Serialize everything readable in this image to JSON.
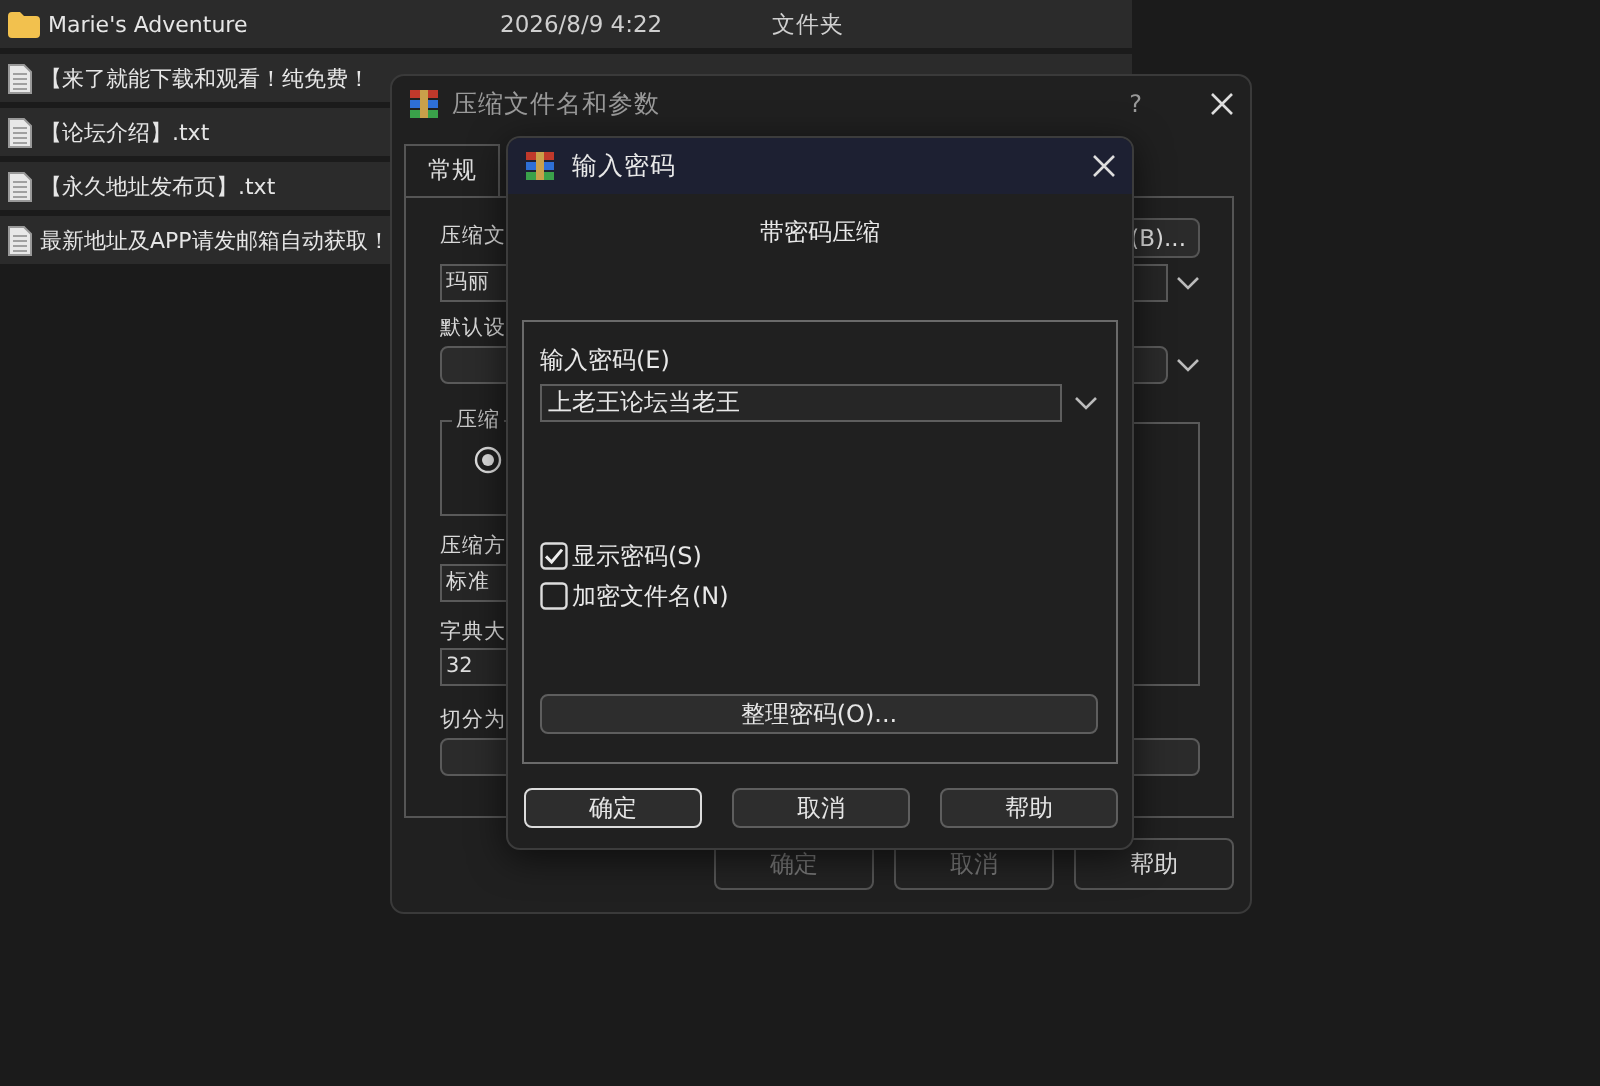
{
  "file_list": {
    "rows": [
      {
        "kind": "folder",
        "name": "Marie's Adventure",
        "date": "2026/8/9 4:22",
        "type": "文件夹"
      },
      {
        "kind": "file",
        "name": "【来了就能下载和观看！纯免费！"
      },
      {
        "kind": "file",
        "name": "【论坛介绍】.txt"
      },
      {
        "kind": "file",
        "name": "【永久地址发布页】.txt"
      },
      {
        "kind": "file",
        "name": "最新地址及APP请发邮箱自动获取！"
      }
    ]
  },
  "archive_dialog": {
    "title": "压缩文件名和参数",
    "help": "?",
    "tabs": [
      {
        "label": "常规",
        "selected": true
      }
    ],
    "archive_name_label": "压缩文",
    "browse_button": "(B)...",
    "archive_name": "玛丽",
    "profile_label": "默认设",
    "format_group": {
      "label": "压缩",
      "radio_selected": true
    },
    "method_label": "压缩方",
    "method": "标准",
    "dictionary_label": "字典大",
    "dictionary": "32",
    "split_label": "切分为",
    "buttons": [
      {
        "label": "确定",
        "disabled": true
      },
      {
        "label": "取消",
        "disabled": true
      },
      {
        "label": "帮助",
        "disabled": false
      }
    ]
  },
  "password_dialog": {
    "title": "输入密码",
    "heading": "带密码压缩",
    "password_label": "输入密码(E)",
    "password": "上老王论坛当老王",
    "options": [
      {
        "label": "显示密码(S)",
        "checked": true
      },
      {
        "label": "加密文件名(N)",
        "checked": false
      }
    ],
    "organize_button": "整理密码(O)...",
    "buttons": [
      {
        "label": "确定",
        "default": true
      },
      {
        "label": "取消",
        "default": false
      },
      {
        "label": "帮助",
        "default": false
      }
    ]
  }
}
